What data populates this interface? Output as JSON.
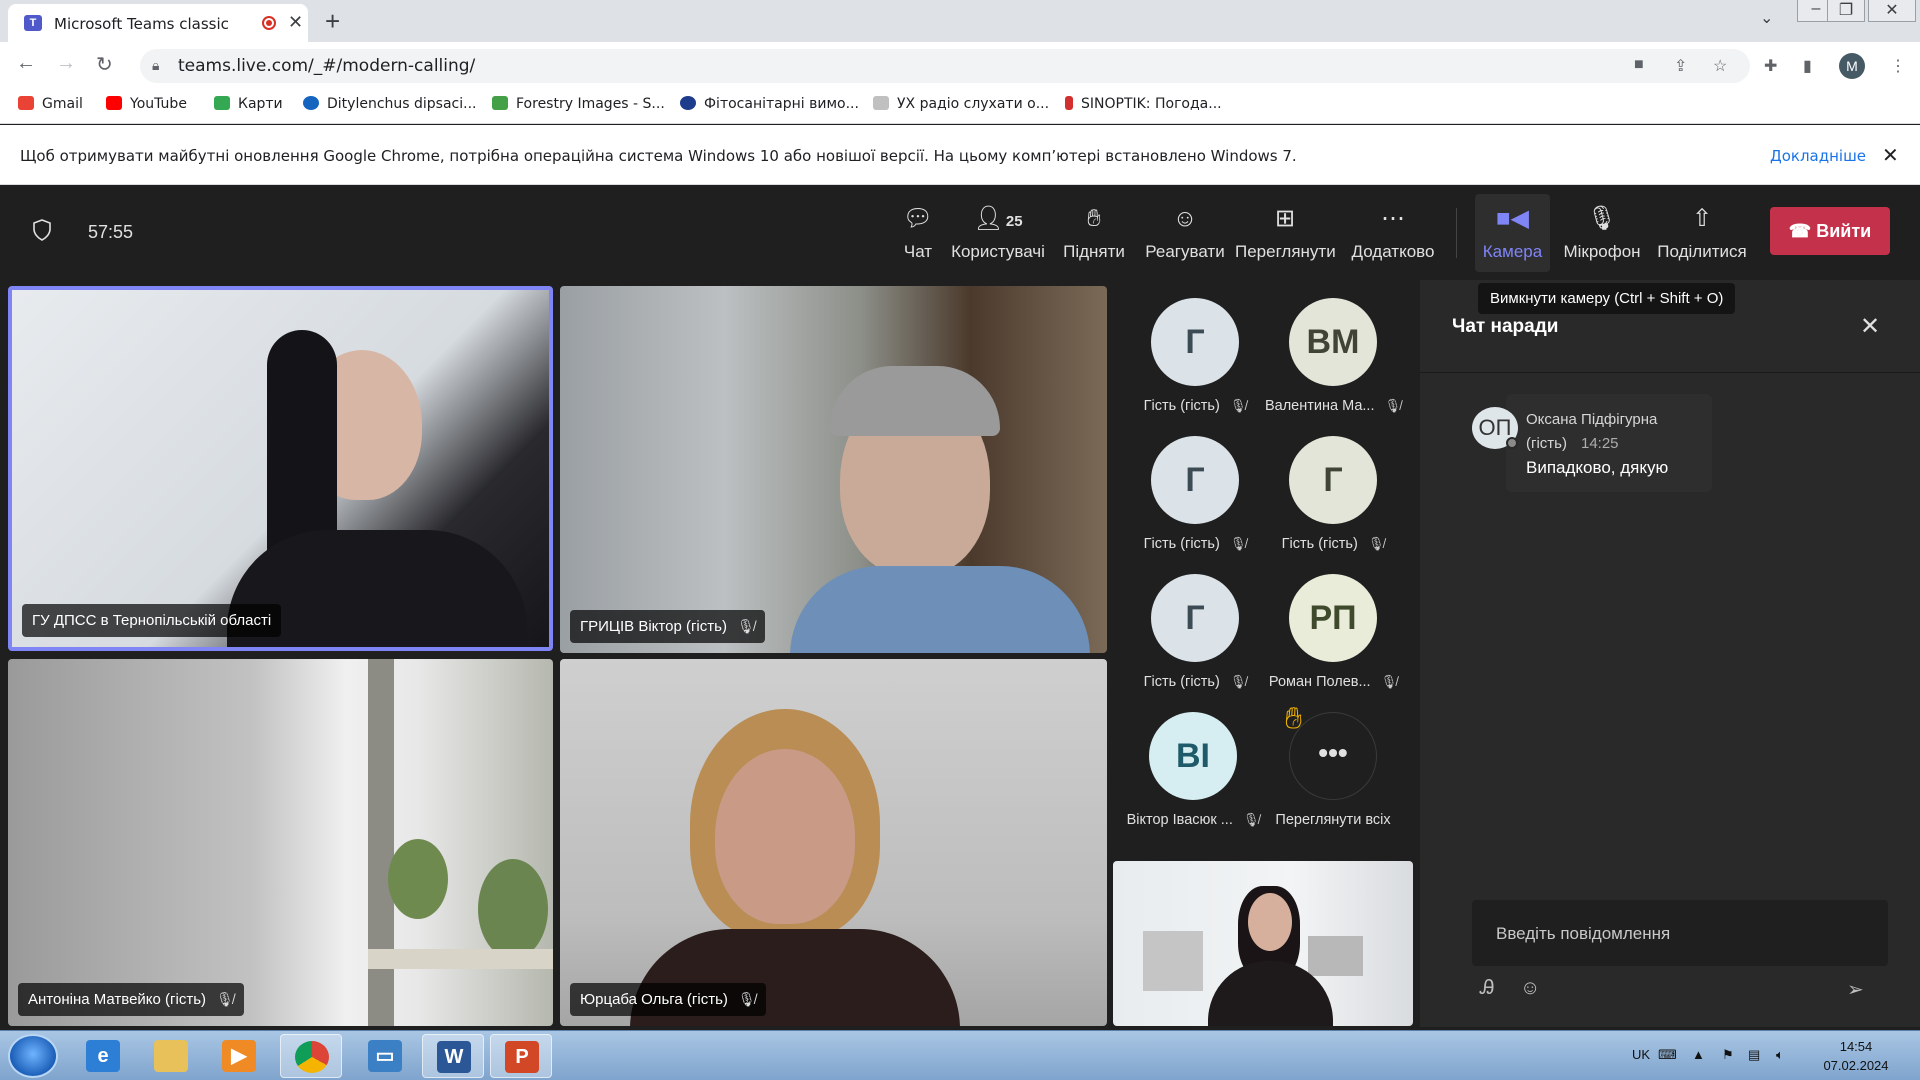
{
  "browser": {
    "tab_title": "Microsoft Teams classic",
    "url": "teams.live.com/_#/modern-calling/",
    "profile_initial": "M",
    "bookmarks": [
      {
        "label": "Gmail",
        "color": "#ea4335"
      },
      {
        "label": "YouTube",
        "color": "#ff0000"
      },
      {
        "label": "Карти",
        "color": "#34a853"
      },
      {
        "label": "Ditylenchus dipsaci...",
        "color": "#1565c0"
      },
      {
        "label": "Forestry Images - S...",
        "color": "#43a047"
      },
      {
        "label": "Фітосанітарні вимо...",
        "color": "#1e3c8c"
      },
      {
        "label": "УХ радіо слухати о...",
        "color": "#c0c0c0"
      },
      {
        "label": "SINOPTIK: Погода...",
        "color": "#d32f2f"
      }
    ],
    "infobar": {
      "message": "Щоб отримувати майбутні оновлення Google Chrome, потрібна операційна система Windows 10 або новішої версії. На цьому комп’ютері встановлено Windows 7.",
      "link": "Докладніше"
    }
  },
  "toolbar": {
    "timer": "57:55",
    "chat": "Чат",
    "people": "Користувачі",
    "people_count": "25",
    "raise": "Підняти",
    "react": "Реагувати",
    "view": "Переглянути",
    "more": "Додатково",
    "camera": "Камера",
    "mic": "Мікрофон",
    "share": "Поділитися",
    "leave": "Вийти",
    "tooltip": "Вимкнути камеру (Ctrl + Shift + O)",
    "accent": "#7f85f5",
    "leave_color": "#c4314b"
  },
  "videos": [
    {
      "name": "ГУ ДПСС в Тернопільській області",
      "muted": false
    },
    {
      "name": "ГРИЦІВ Віктор (гість)",
      "muted": true
    },
    {
      "name": "Антоніна Матвейко (гість)",
      "muted": true
    },
    {
      "name": "Юрцаба Ольга (гість)",
      "muted": true
    }
  ],
  "participants": [
    {
      "initials": "Г",
      "name": "Гість (гість)",
      "bg": "#dbe3e8",
      "fg": "#3d4b55"
    },
    {
      "initials": "ВМ",
      "name": "Валентина Ма...",
      "bg": "#e3e5d8",
      "fg": "#3f4436"
    },
    {
      "initials": "Г",
      "name": "Гість (гість)",
      "bg": "#dbe3e8",
      "fg": "#3d4b55"
    },
    {
      "initials": "Г",
      "name": "Гість (гість)",
      "bg": "#e3e5d8",
      "fg": "#3f4436"
    },
    {
      "initials": "Г",
      "name": "Гість (гість)",
      "bg": "#dbe3e8",
      "fg": "#3d4b55"
    },
    {
      "initials": "РП",
      "name": "Роман Полев...",
      "bg": "#e8ecd8",
      "fg": "#3f4a2c"
    },
    {
      "initials": "ВІ",
      "name": "Віктор Івасюк ...",
      "bg": "#d6eef2",
      "fg": "#1f5a6b"
    }
  ],
  "view_all": "Переглянути всіх",
  "chat": {
    "header": "Чат наради",
    "avatar_initials": "ОП",
    "author": "Оксана Підфігурна (гість)",
    "time": "14:25",
    "message": "Випадково, дякую",
    "placeholder": "Введіть повідомлення"
  },
  "taskbar": {
    "lang": "UK",
    "time": "14:54",
    "date": "07.02.2024"
  }
}
